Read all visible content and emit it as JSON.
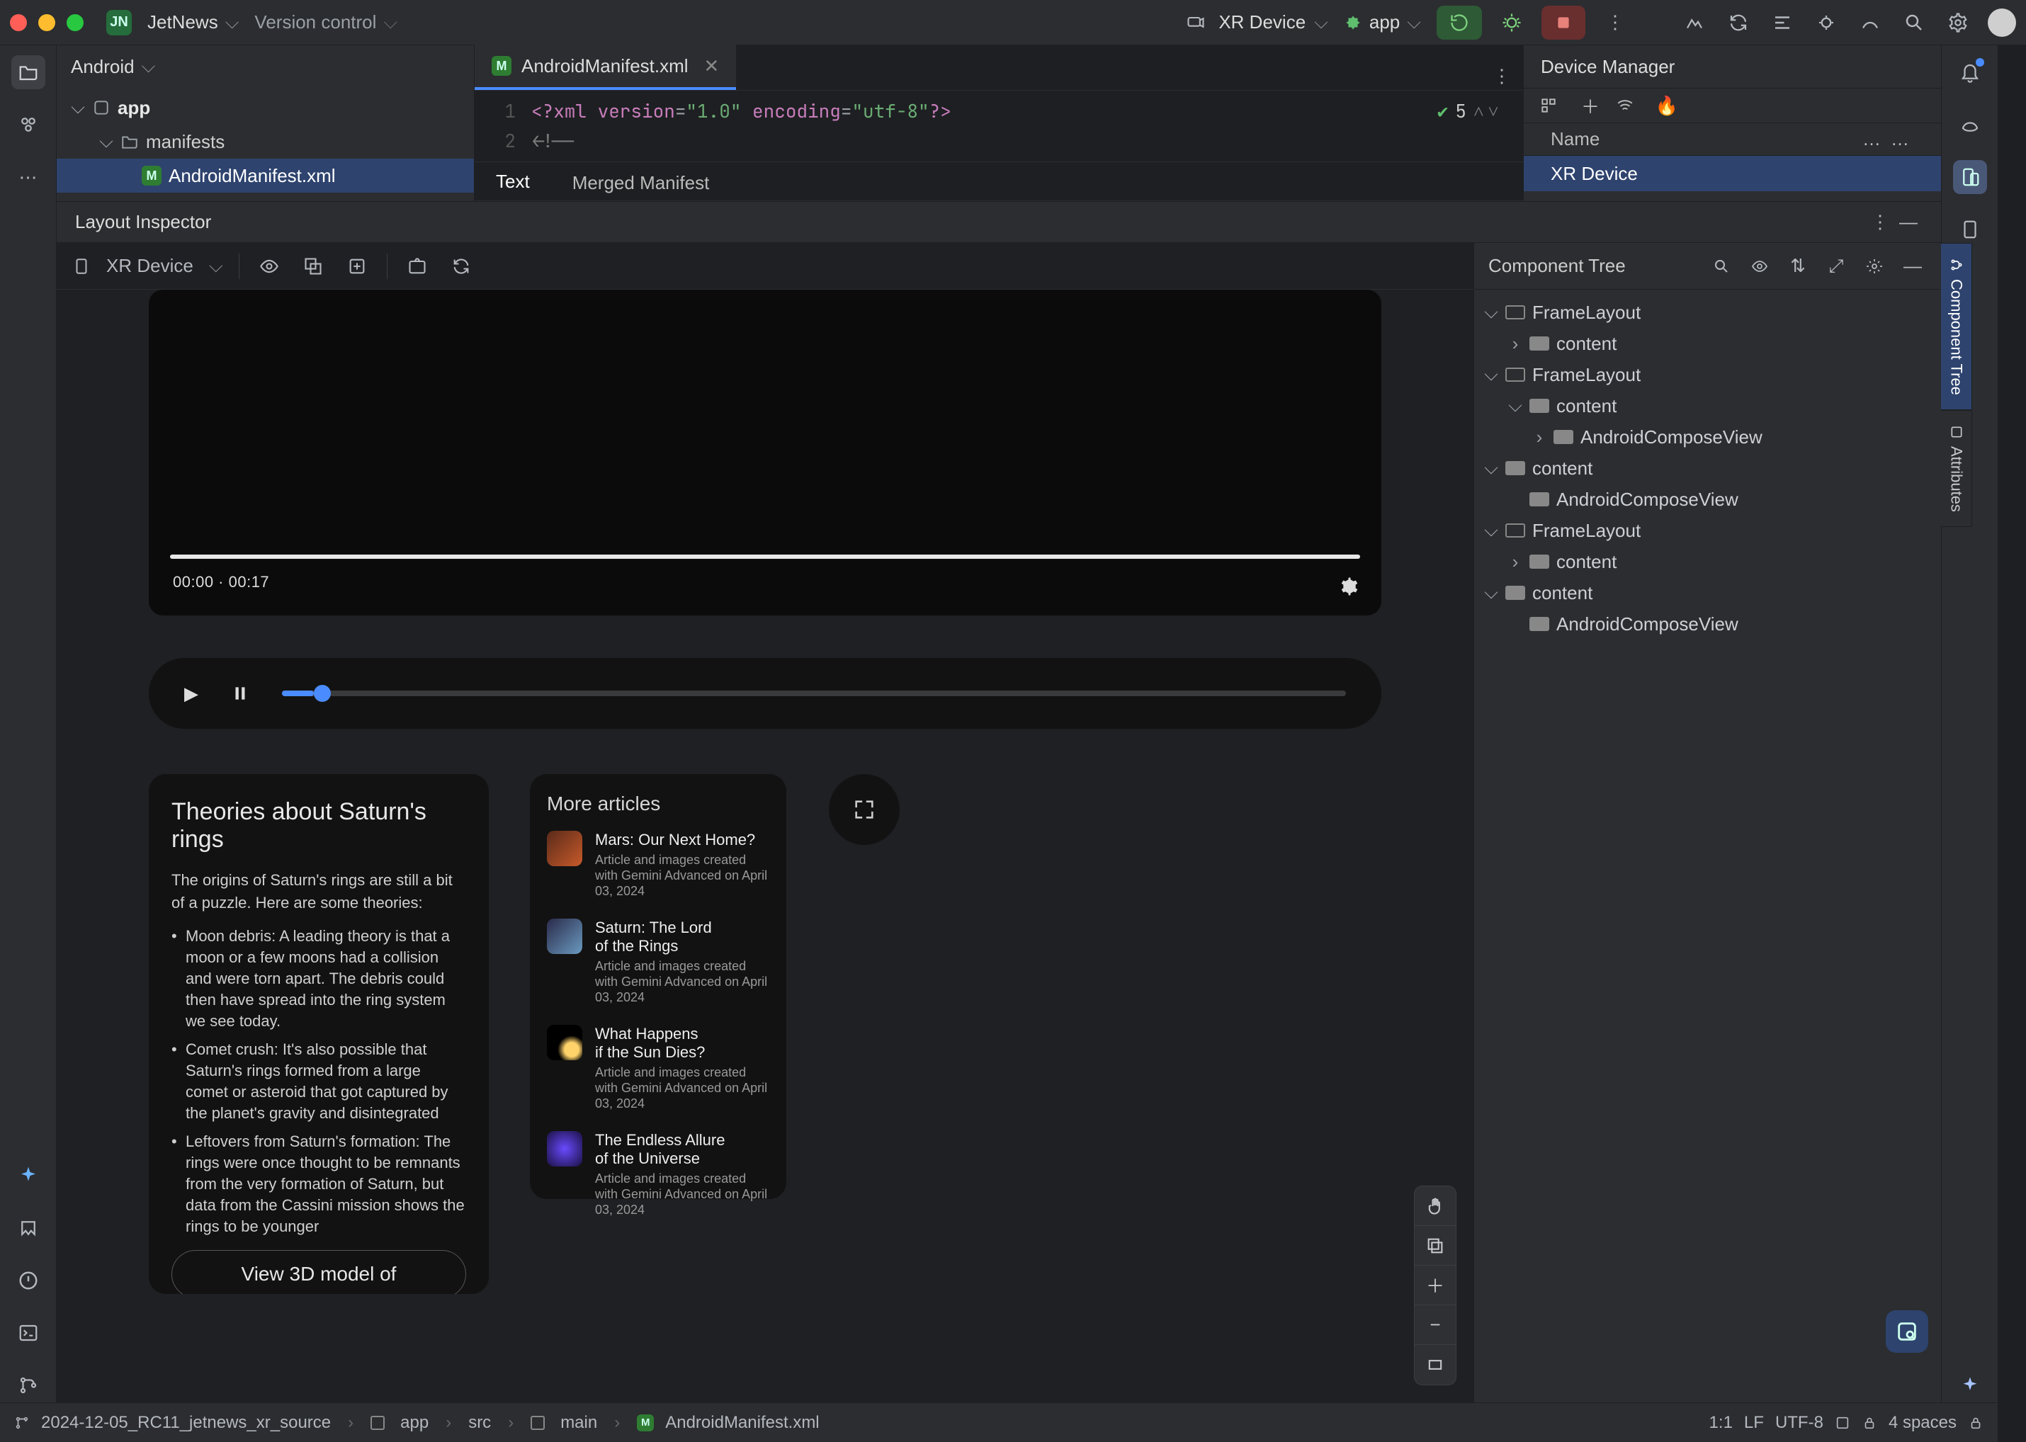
{
  "titlebar": {
    "project_initials": "JN",
    "project_name": "JetNews",
    "menu_vcs": "Version control",
    "device_label": "XR Device",
    "run_config": "app"
  },
  "project_tool": {
    "title": "Android",
    "nodes": {
      "app": "app",
      "manifests": "manifests",
      "manifest_file": "AndroidManifest.xml"
    }
  },
  "editor": {
    "tab_file": "AndroidManifest.xml",
    "inspection_count": "5",
    "code": {
      "l1a": "<?",
      "l1b": "xml version",
      "l1c": "=",
      "l1d": "\"1.0\"",
      "l1e": " encoding",
      "l1f": "=",
      "l1g": "\"utf-8\"",
      "l1h": "?>",
      "l2": "<!--"
    },
    "subtabs": {
      "text": "Text",
      "merged": "Merged Manifest"
    }
  },
  "device_manager": {
    "title": "Device Manager",
    "name_col": "Name",
    "dots1": "…",
    "dots2": "…",
    "device": "XR Device"
  },
  "layout_inspector": {
    "title": "Layout Inspector",
    "toolbar_device": "XR Device",
    "tree_title": "Component Tree",
    "side_tab_tree": "Component Tree",
    "side_tab_attrs": "Attributes",
    "tree": {
      "fl": "FrameLayout",
      "content": "content",
      "acv": "AndroidComposeView"
    }
  },
  "preview": {
    "video_time": "00:00  ·  00:17",
    "article": {
      "title": "Theories about Saturn's rings",
      "intro": "The origins of Saturn's rings are still a bit of a puzzle. Here are some theories:",
      "b1": "Moon debris: A leading theory is that a moon or a few moons had a collision and were torn apart. The debris could then have spread into the ring system we see today.",
      "b2": "Comet crush: It's also possible that Saturn's rings formed from a large comet or asteroid that got captured by the planet's gravity and disintegrated",
      "b3": "Leftovers from Saturn's formation: The rings were once thought to be remnants from the very formation of Saturn, but data from the Cassini mission shows the rings to be younger",
      "cta": "View 3D model of"
    },
    "more": {
      "title": "More articles",
      "a1_t": "Mars: Our Next Home?",
      "sub": "Article and images created with Gemini Advanced on April 03, 2024",
      "a2_t1": "Saturn: The Lord",
      "a2_t2": "of the Rings",
      "a3_t1": "What Happens",
      "a3_t2": "if the Sun Dies?",
      "a4_t1": "The Endless Allure",
      "a4_t2": "of the Universe"
    }
  },
  "status": {
    "branch": "2024-12-05_RC11_jetnews_xr_source",
    "c_app": "app",
    "c_src": "src",
    "c_main": "main",
    "c_file": "AndroidManifest.xml",
    "pos": "1:1",
    "le": "LF",
    "enc": "UTF-8",
    "indent": "4 spaces"
  }
}
